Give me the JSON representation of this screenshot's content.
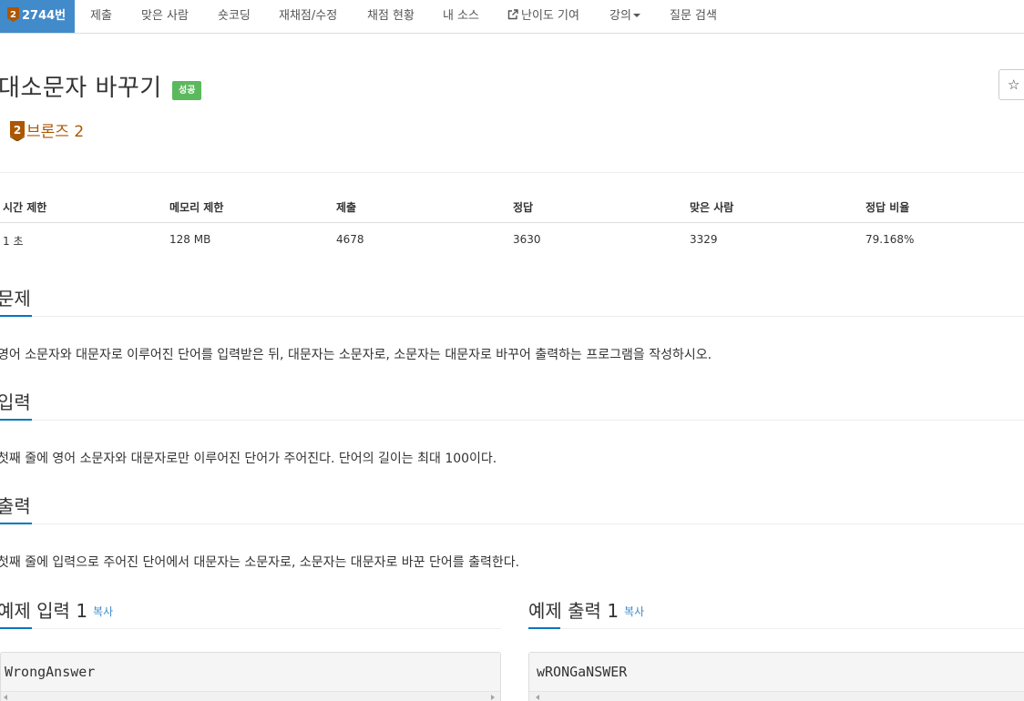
{
  "nav": {
    "problem_number": "2744번",
    "items": [
      "제출",
      "맞은 사람",
      "숏코딩",
      "재채점/수정",
      "채점 현황",
      "내 소스",
      "난이도 기여",
      "강의",
      "질문 검색"
    ]
  },
  "problem": {
    "title": "대소문자 바꾸기",
    "result_label": "성공",
    "tier_number": "2",
    "tier_name": "브론즈 2",
    "star_icon": "☆"
  },
  "stats": {
    "headers": [
      "시간 제한",
      "메모리 제한",
      "제출",
      "정답",
      "맞은 사람",
      "정답 비율"
    ],
    "values": [
      "1 초",
      "128 MB",
      "4678",
      "3630",
      "3329",
      "79.168%"
    ]
  },
  "sections": {
    "description_title": "문제",
    "description_text": "영어 소문자와 대문자로 이루어진 단어를 입력받은 뒤, 대문자는 소문자로, 소문자는 대문자로 바꾸어 출력하는 프로그램을 작성하시오.",
    "input_title": "입력",
    "input_text": "첫째 줄에 영어 소문자와 대문자로만 이루어진 단어가 주어진다. 단어의 길이는 최대 100이다.",
    "output_title": "출력",
    "output_text": "첫째 줄에 입력으로 주어진 단어에서 대문자는 소문자로, 소문자는 대문자로 바꾼 단어를 출력한다."
  },
  "samples": {
    "input_title": "예제 입력 1",
    "output_title": "예제 출력 1",
    "copy_label": "복사",
    "input_value": "WrongAnswer",
    "output_value": "wRONGaNSWER"
  },
  "colors": {
    "nav_active": "#428bca",
    "success": "#5cb85c",
    "bronze": "#ad5600",
    "section_accent": "#0076c0"
  }
}
